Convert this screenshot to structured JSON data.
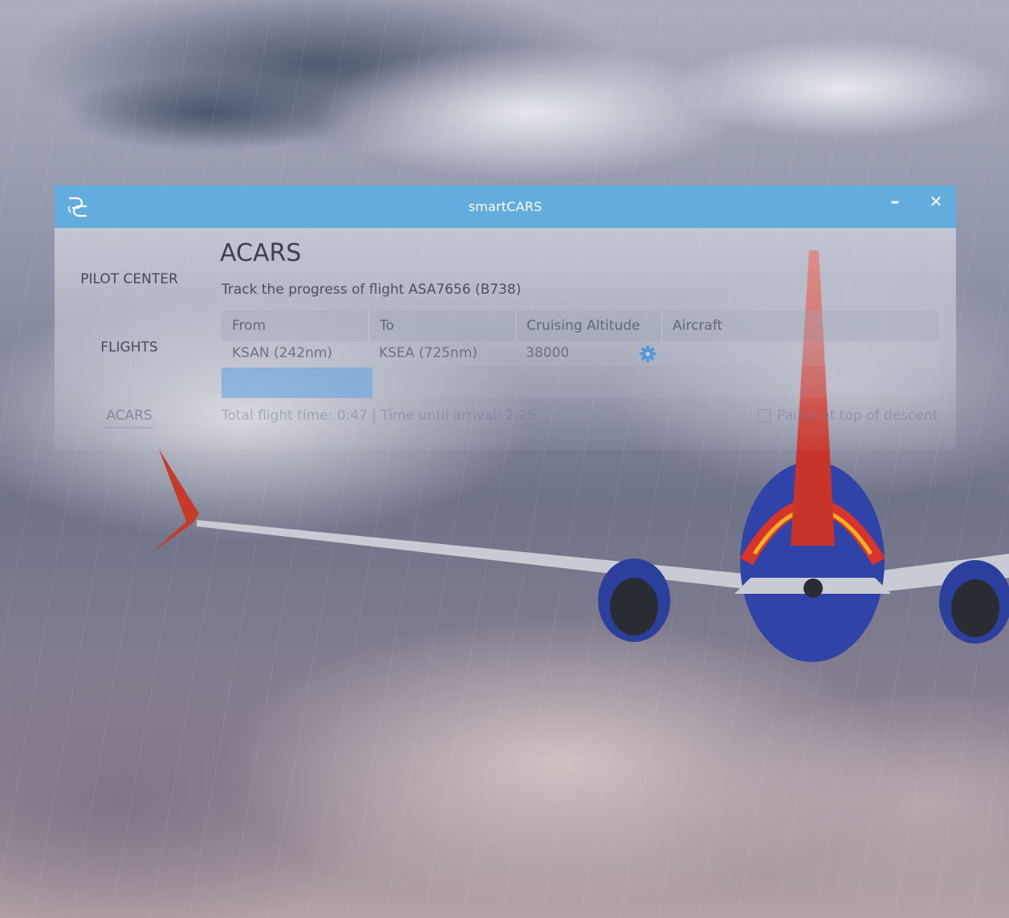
{
  "window": {
    "title": "smartCARS",
    "minimize_label": "–",
    "close_label": "✕",
    "accent_color": "#54a8de"
  },
  "sidebar": {
    "items": [
      {
        "label": "PILOT CENTER",
        "active": false
      },
      {
        "label": "FLIGHTS",
        "active": false
      },
      {
        "label": "ACARS",
        "active": true
      }
    ]
  },
  "main": {
    "title": "ACARS",
    "subtitle": "Track the progress of flight ASA7656 (B738)",
    "table": {
      "headers": [
        "From",
        "To",
        "Cruising Altitude",
        "Aircraft"
      ],
      "row": {
        "from": "KSAN (242nm)",
        "to": "KSEA (725nm)",
        "cruising_altitude": "38000",
        "aircraft": ""
      }
    },
    "progress_fraction": 0.21,
    "flight_time_status": "Total flight time: 0:47 | Time until arrival: 2:25",
    "pause_at_tod": {
      "label": "Pause at top of descent",
      "checked": false
    }
  },
  "icons": {
    "app_logo": "smartcars-logo-icon",
    "settings": "gear-icon"
  }
}
